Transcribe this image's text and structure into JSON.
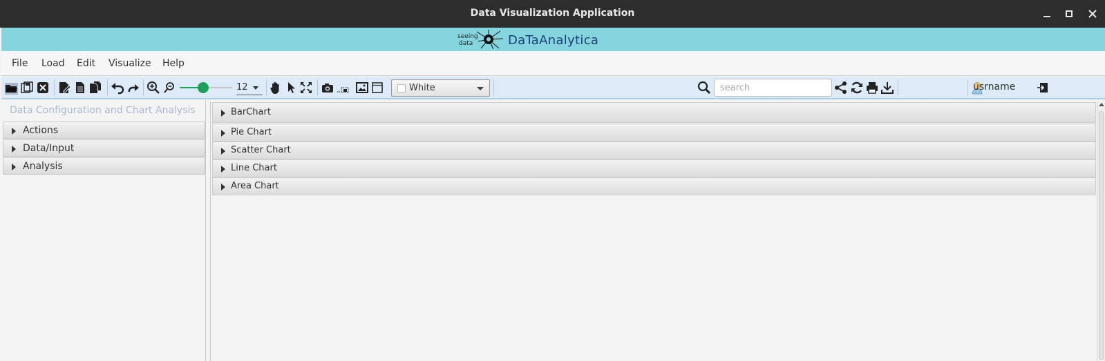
{
  "window": {
    "title": "Data Visualization Application",
    "controls": [
      "minimize-icon",
      "maximize-icon",
      "close-icon"
    ]
  },
  "brand": {
    "logo_text_top": "seeing",
    "logo_text_bottom": "data",
    "name": "DaTaAnalytica",
    "bar_color": "#84d5dd",
    "name_color": "#1e3f7a"
  },
  "menu": {
    "items": [
      "File",
      "Load",
      "Edit",
      "Visualize",
      "Help"
    ]
  },
  "toolbar": {
    "icons": [
      "open-folder-icon",
      "save-all-icon",
      "close-file-icon",
      "edit-document-icon",
      "document-icon",
      "copy-icon",
      "undo-icon",
      "redo-icon",
      "zoom-in-icon",
      "zoom-out-icon",
      "pan-hand-icon",
      "pointer-icon",
      "fit-screen-icon",
      "camera-icon",
      "screenshot-region-icon",
      "image-icon",
      "frame-icon",
      "search-icon",
      "share-icon",
      "refresh-icon",
      "print-icon",
      "download-icon",
      "user-icon",
      "logout-icon"
    ],
    "zoom_slider_value": 0.45,
    "zoom_value": "12",
    "background_color_label": "White",
    "search_placeholder": "search",
    "username": "usrname",
    "accent_color": "#1aa259"
  },
  "left_panel": {
    "title": "Data Configuration and Chart Analysis",
    "sections": [
      "Actions",
      "Data/Input",
      "Analysis"
    ]
  },
  "right_panel": {
    "sections": [
      "BarChart",
      "Pie Chart",
      "Scatter Chart",
      "Line Chart",
      "Area Chart"
    ]
  }
}
